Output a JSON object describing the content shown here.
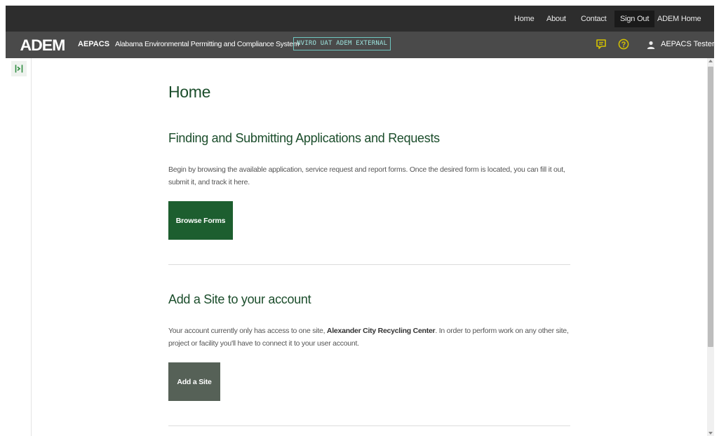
{
  "topnav": {
    "home": "Home",
    "about": "About",
    "contact": "Contact",
    "sign_out": "Sign Out",
    "adem_home": "ADEM Home"
  },
  "appbar": {
    "logo": "ADEM",
    "app_abbr": "AEPACS",
    "app_name": "Alabama Environmental Permitting and Compliance System",
    "env_badge": "NVIRO UAT ADEM EXTERNAL",
    "user_name": "AEPACS Tester"
  },
  "main": {
    "page_title": "Home",
    "forms_section": {
      "heading": "Finding and Submitting Applications and Requests",
      "text": "Begin by browsing the available application, service request and report forms. Once the desired form is located, you can fill it out, submit it, and track it here.",
      "button": "Browse Forms"
    },
    "site_section": {
      "heading": "Add a Site to your account",
      "text_before": "Your account currently only has access to one site,",
      "site_name": "Alexander City Recycling Center",
      "text_after": ". In order to perform work on any other site, project or facility you'll have to connect it to your user account.",
      "button": "Add a Site"
    }
  },
  "colors": {
    "heading_green": "#1b4d2b",
    "primary_button": "#1d5e2f",
    "secondary_button": "#566157",
    "topbar": "#2d2d2d",
    "appbar": "#4a4a4a",
    "env_badge_border": "#6ec6c0",
    "help_icon": "#d4c200"
  },
  "icons": {
    "rail": "expand-panel-icon",
    "chat": "feedback-chat-icon",
    "help": "help-circle-icon",
    "user": "user-icon"
  }
}
